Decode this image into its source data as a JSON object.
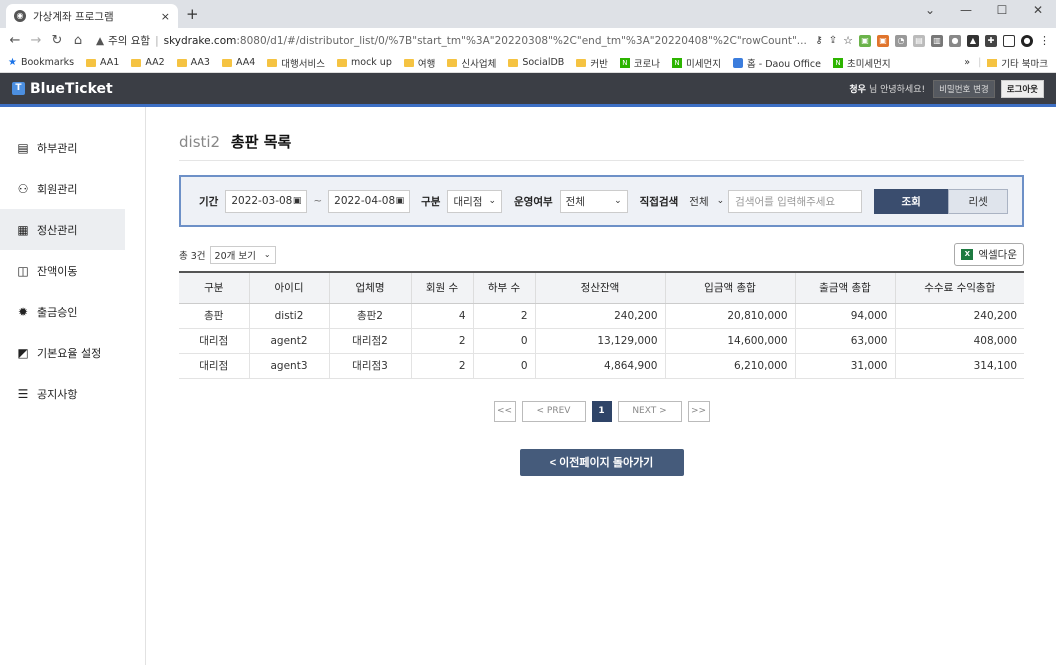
{
  "browser": {
    "tab_title": "가상계좌 프로그램",
    "tab_close": "×",
    "new_tab": "+",
    "win_min": "—",
    "win_max": "☐",
    "win_close": "✕",
    "security_label": "주의 요함",
    "url_host": "skydrake.com",
    "url_path": ":8080/d1/#/distributor_list/0/%7B\"start_tm\"%3A\"20220308\"%2C\"end_tm\"%3A\"20220408\"%2C\"rowCount\"...",
    "bookmarks": [
      {
        "label": "Bookmarks",
        "icon": "star-icon"
      },
      {
        "label": "AA1",
        "icon": "folder-icon"
      },
      {
        "label": "AA2",
        "icon": "folder-icon"
      },
      {
        "label": "AA3",
        "icon": "folder-icon"
      },
      {
        "label": "AA4",
        "icon": "folder-icon"
      },
      {
        "label": "대행서비스",
        "icon": "folder-icon"
      },
      {
        "label": "mock up",
        "icon": "folder-icon"
      },
      {
        "label": "여행",
        "icon": "folder-icon"
      },
      {
        "label": "신사업체",
        "icon": "folder-icon"
      },
      {
        "label": "SocialDB",
        "icon": "folder-icon"
      },
      {
        "label": "커반",
        "icon": "folder-icon"
      },
      {
        "label": "코로나",
        "icon": "naver-icon"
      },
      {
        "label": "미세먼지",
        "icon": "naver-icon"
      },
      {
        "label": "홈 - Daou Office",
        "icon": "daou-icon"
      },
      {
        "label": "초미세먼지",
        "icon": "naver-icon"
      }
    ],
    "bookmarks_more": "»",
    "other_bookmarks": "기타 북마크"
  },
  "header": {
    "logo": "BlueTicket",
    "user_name": "청우",
    "greeting": "님 안녕하세요!",
    "change_password": "비밀번호 변경",
    "logout": "로그아웃"
  },
  "sidebar": {
    "items": [
      {
        "label": "하부관리",
        "icon": "org-icon",
        "active": false
      },
      {
        "label": "회원관리",
        "icon": "users-icon",
        "active": false
      },
      {
        "label": "정산관리",
        "icon": "calculator-icon",
        "active": true
      },
      {
        "label": "잔액이동",
        "icon": "transfer-icon",
        "active": false
      },
      {
        "label": "출금승인",
        "icon": "badge-check-icon",
        "active": false
      },
      {
        "label": "기본요율 설정",
        "icon": "rate-icon",
        "active": false
      },
      {
        "label": "공지사항",
        "icon": "list-icon",
        "active": false
      }
    ]
  },
  "page": {
    "distributor_id": "disti2",
    "title": "총판 목록"
  },
  "filter": {
    "period_label": "기간",
    "start_date": "2022-03-08",
    "end_date": "2022-04-08",
    "tilde": "~",
    "type_label": "구분",
    "type_value": "대리점",
    "status_label": "운영여부",
    "status_value": "전체",
    "direct_label": "직접검색",
    "direct_value": "전체",
    "search_placeholder": "검색어를 입력해주세요",
    "search_button": "조회",
    "reset_button": "리셋"
  },
  "list": {
    "total": "총 3건",
    "page_size": "20개 보기",
    "excel_button": "엑셀다운"
  },
  "table": {
    "headers": [
      "구분",
      "아이디",
      "업체명",
      "회원 수",
      "하부 수",
      "정산잔액",
      "입금액 총합",
      "출금액 총합",
      "수수료 수익총합"
    ],
    "rows": [
      [
        "총판",
        "disti2",
        "총판2",
        "4",
        "2",
        "240,200",
        "20,810,000",
        "94,000",
        "240,200"
      ],
      [
        "대리점",
        "agent2",
        "대리점2",
        "2",
        "0",
        "13,129,000",
        "14,600,000",
        "63,000",
        "408,000"
      ],
      [
        "대리점",
        "agent3",
        "대리점3",
        "2",
        "0",
        "4,864,900",
        "6,210,000",
        "31,000",
        "314,100"
      ]
    ]
  },
  "pagination": {
    "first": "<<",
    "prev": "< PREV",
    "current": "1",
    "next": "NEXT >",
    "last": ">>"
  },
  "back_button": "< 이전페이지 돌아가기"
}
